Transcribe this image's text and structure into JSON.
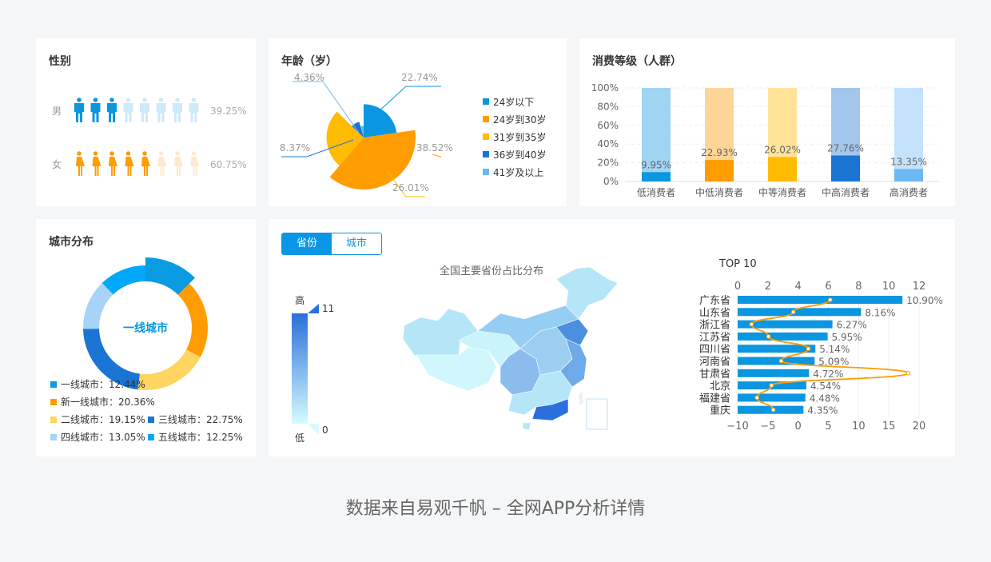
{
  "gender": {
    "title": "性别",
    "rows": [
      {
        "label": "男",
        "percent": "39.25%",
        "filled": 3,
        "total": 8,
        "color": "#0a96e0",
        "light": "#cde9fa"
      },
      {
        "label": "女",
        "percent": "60.75%",
        "filled": 5,
        "total": 8,
        "color": "#ff9c00",
        "light": "#fde9cc"
      }
    ]
  },
  "age": {
    "title": "年龄（岁）",
    "chart_data": {
      "type": "pie",
      "rose": "radius",
      "slices": [
        {
          "name": "24岁以下",
          "value": 22.74,
          "label": "22.74%",
          "color": "#0a96e0"
        },
        {
          "name": "24岁到30岁",
          "value": 38.52,
          "label": "38.52%",
          "color": "#ff9c00"
        },
        {
          "name": "31岁到35岁",
          "value": 26.01,
          "label": "26.01%",
          "color": "#ffbb00"
        },
        {
          "name": "36岁到40岁",
          "value": 8.37,
          "label": "8.37%",
          "color": "#1a74d4"
        },
        {
          "name": "41岁及以上",
          "value": 4.36,
          "label": "4.36%",
          "color": "#6cb8f5"
        }
      ],
      "legend": "right"
    }
  },
  "consumption": {
    "title": "消费等级（人群）",
    "chart_data": {
      "type": "bar",
      "stacked_background": true,
      "categories": [
        "低消费者",
        "中低消费者",
        "中等消费者",
        "中高消费者",
        "高消费者"
      ],
      "values": [
        9.95,
        22.93,
        26.02,
        27.76,
        13.35
      ],
      "labels": [
        "9.95%",
        "22.93%",
        "26.02%",
        "27.76%",
        "13.35%"
      ],
      "colors": [
        "#0a96e0",
        "#ff9c00",
        "#ffbb00",
        "#1a74d4",
        "#6cb8f5"
      ],
      "bg_colors": [
        "#9fd4f3",
        "#fdd596",
        "#ffe398",
        "#a3c7ec",
        "#c4e2fb"
      ],
      "yticks": [
        "0%",
        "20%",
        "40%",
        "60%",
        "80%",
        "100%"
      ],
      "ylim": [
        0,
        100
      ],
      "grid": true
    }
  },
  "city": {
    "title": "城市分布",
    "center_label": "一线城市",
    "chart_data": {
      "type": "pie",
      "donut": true,
      "highlighted": "一线城市",
      "slices": [
        {
          "name": "一线城市",
          "value": 12.44,
          "label": "一线城市：12.44%",
          "color": "#0a9be3"
        },
        {
          "name": "新一线城市",
          "value": 20.36,
          "label": "新一线城市：20.36%",
          "color": "#ff9c00"
        },
        {
          "name": "二线城市",
          "value": 19.15,
          "label": "二线城市：19.15%",
          "color": "#ffd460"
        },
        {
          "name": "三线城市",
          "value": 22.75,
          "label": "三线城市：22.75%",
          "color": "#1a74d4"
        },
        {
          "name": "四线城市",
          "value": 13.05,
          "label": "四线城市：13.05%",
          "color": "#a6d3f7"
        },
        {
          "name": "五线城市",
          "value": 12.25,
          "label": "五线城市：12.25%",
          "color": "#00a8f8"
        }
      ]
    }
  },
  "region": {
    "tabs": [
      {
        "label": "省份",
        "active": true
      },
      {
        "label": "城市",
        "active": false
      }
    ],
    "map_title": "全国主要省份占比分布",
    "visual_map": {
      "high_label": "高",
      "low_label": "低",
      "max": "11",
      "min": "0",
      "color_high": "#2a6fdb",
      "color_low": "#d6fbff"
    },
    "top10": {
      "title": "TOP 10",
      "chart_data": {
        "type": "bar",
        "orientation": "horizontal",
        "categories": [
          "广东省",
          "山东省",
          "浙江省",
          "江苏省",
          "四川省",
          "河南省",
          "甘肃省",
          "北京",
          "福建省",
          "重庆"
        ],
        "values": [
          10.9,
          8.16,
          6.27,
          5.95,
          5.14,
          5.09,
          4.72,
          4.54,
          4.48,
          4.35
        ],
        "labels": [
          "10.90%",
          "8.16%",
          "6.27%",
          "5.95%",
          "5.14%",
          "5.09%",
          "4.72%",
          "4.54%",
          "4.48%",
          "4.35%"
        ],
        "bar_axis": {
          "ticks": [
            "0",
            "2",
            "4",
            "6",
            "8",
            "10",
            "12"
          ],
          "range": [
            0,
            12
          ],
          "position": "top"
        },
        "line_axis": {
          "ticks": [
            "−10",
            "−5",
            "0",
            "5",
            "10",
            "15",
            "20"
          ],
          "range": [
            -10,
            20
          ],
          "position": "bottom"
        },
        "line_values": [
          5.3,
          -0.8,
          -7.7,
          -4.9,
          1.7,
          -2.8,
          18.2,
          -4.4,
          -6.8,
          -4.1
        ],
        "bar_color": "#0a96e0",
        "line_color": "#ff9c00"
      }
    }
  },
  "footer": "数据来自易观千帆 – 全网APP分析详情"
}
